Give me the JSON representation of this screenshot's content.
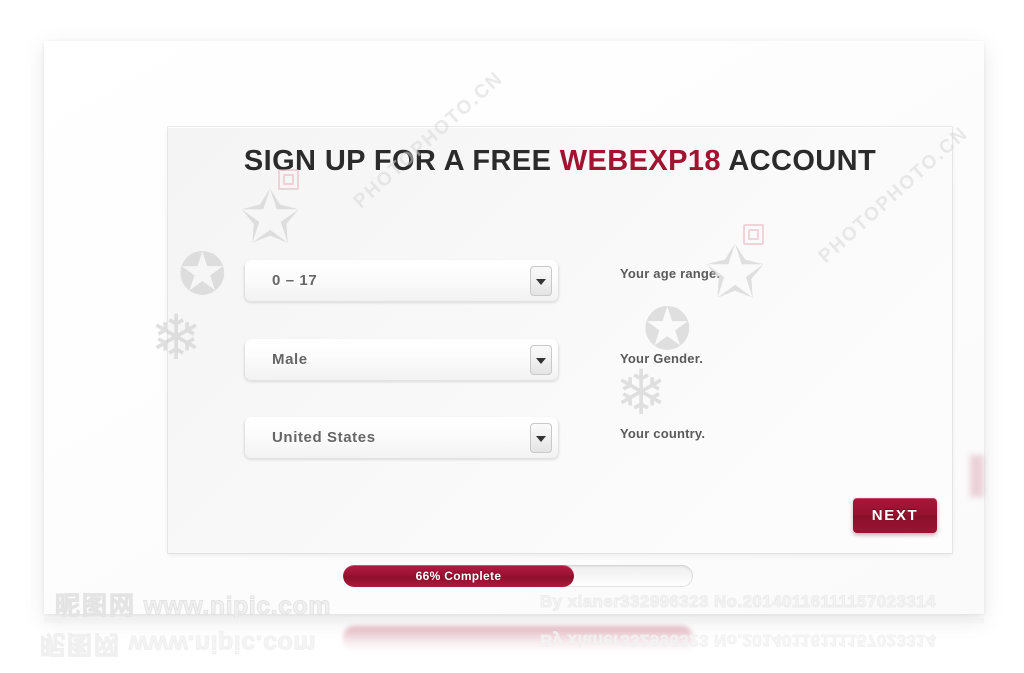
{
  "headline": {
    "prefix": "SIGN UP FOR A FREE ",
    "brand": "WEBEXP18",
    "suffix": " ACCOUNT"
  },
  "form": {
    "rows": [
      {
        "name": "age-range",
        "value": "0 – 17",
        "label": "Your age range.",
        "arrow_icon": "chevron-down-icon"
      },
      {
        "name": "gender",
        "value": "Male",
        "label": "Your Gender.",
        "arrow_icon": "chevron-down-icon"
      },
      {
        "name": "country",
        "value": "United States",
        "label": "Your country.",
        "arrow_icon": "chevron-down-icon"
      }
    ]
  },
  "next_button": {
    "label": "NEXT"
  },
  "progress": {
    "text": "66% Complete",
    "percent": 66
  },
  "watermarks": {
    "photophoto_text": "PHOTOPHOTO.CN",
    "nipic_cn": "昵图网",
    "nipic_url": "www.nipic.com",
    "credit": "By xianer332996323  No.20140116111157023314"
  },
  "colors": {
    "brand_red": "#a01432",
    "button_red": "#96122f",
    "progress_red": "#9d1234",
    "panel_bg": "#f7f7f7",
    "text_dark": "#2b2b2b",
    "text_muted": "#666666"
  }
}
